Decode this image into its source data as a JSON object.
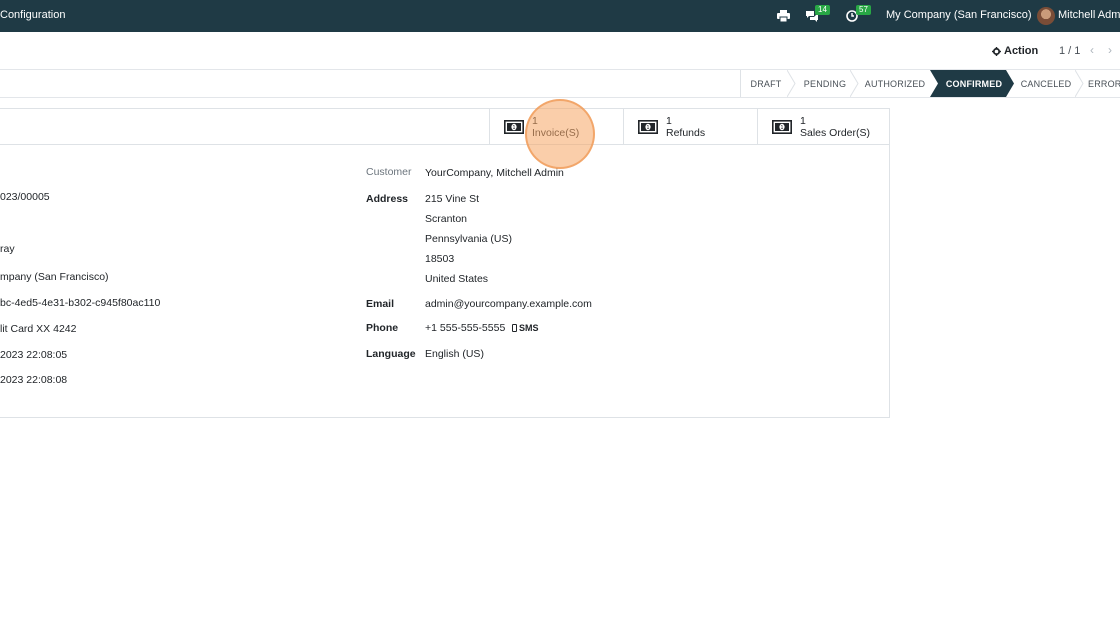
{
  "navbar": {
    "menu_item": "Configuration",
    "chat_badge": "14",
    "activity_badge": "57",
    "company": "My Company (San Francisco)",
    "user": "Mitchell Admi"
  },
  "control": {
    "action_label": "Action",
    "pager": "1 / 1"
  },
  "statusbar": {
    "stages": [
      "DRAFT",
      "PENDING",
      "AUTHORIZED",
      "CONFIRMED",
      "CANCELED",
      "ERROR"
    ],
    "active": "CONFIRMED"
  },
  "buttons": [
    {
      "count": "1",
      "label": "Invoice(S)"
    },
    {
      "count": "1",
      "label": "Refunds"
    },
    {
      "count": "1",
      "label": "Sales Order(S)"
    }
  ],
  "left_values": [
    "023/00005",
    "ray",
    "mpany (San Francisco)",
    "bc-4ed5-4e31-b302-c945f80ac110",
    "lit Card XX 4242",
    "2023 22:08:05",
    "2023 22:08:08"
  ],
  "customer": {
    "customer_label": "Customer",
    "customer_value": "YourCompany, Mitchell Admin",
    "address_label": "Address",
    "address_lines": [
      "215 Vine St",
      "Scranton",
      "Pennsylvania (US)",
      "18503",
      "United States"
    ],
    "email_label": "Email",
    "email_value": "admin@yourcompany.example.com",
    "phone_label": "Phone",
    "phone_value": "+1 555-555-5555",
    "sms_label": "SMS",
    "language_label": "Language",
    "language_value": "English (US)"
  },
  "colors": {
    "navbar": "#1f3a45",
    "badge": "#28a745",
    "active_stage": "#1f3a45",
    "click_highlight": "#f5a564"
  }
}
